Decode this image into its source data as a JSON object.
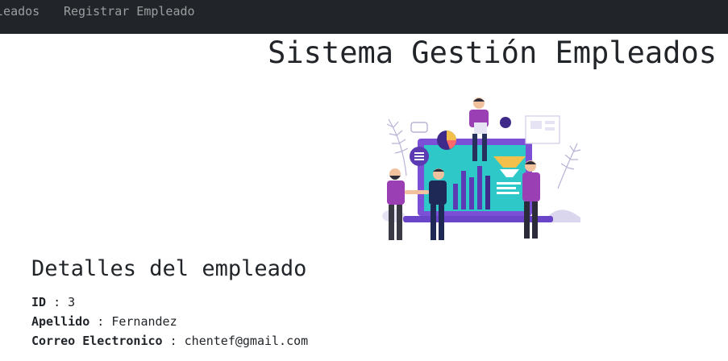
{
  "navbar": {
    "links": [
      "pleados",
      "Registrar Empleado"
    ]
  },
  "header": {
    "title": "Sistema Gestión Empleados"
  },
  "details": {
    "title": "Detalles del empleado",
    "separator": ":",
    "rows": [
      {
        "label": "ID",
        "value": "3"
      },
      {
        "label": "Apellido",
        "value": "Fernandez"
      },
      {
        "label": "Correo Electronico",
        "value": "chentef@gmail.com"
      }
    ]
  },
  "colors": {
    "navbar_bg": "#212529",
    "nav_link": "rgba(255,255,255,0.55)",
    "text": "#212529",
    "accent_purple": "#6c3fc5",
    "accent_teal": "#2ec8c8"
  }
}
